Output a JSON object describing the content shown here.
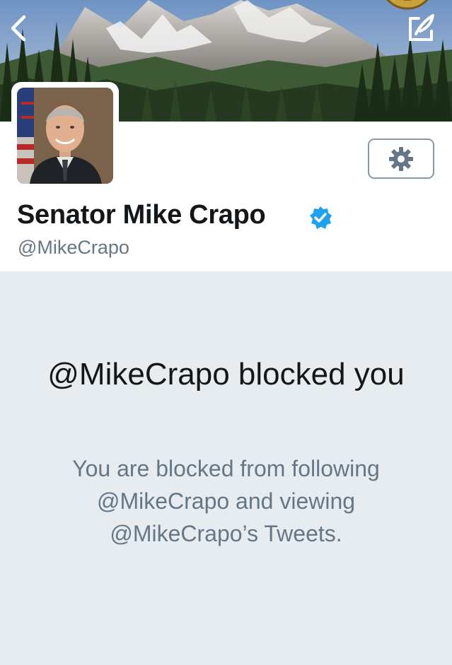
{
  "header": {
    "back_icon": "chevron-left-icon",
    "share_icon": "external-link-icon"
  },
  "profile": {
    "display_name": "Senator Mike Crapo",
    "handle": "@MikeCrapo",
    "verified_icon": "verified-badge-icon",
    "settings_icon": "gear-icon"
  },
  "blocked": {
    "title": "@MikeCrapo blocked you",
    "description": "You are blocked from following @MikeCrapo and viewing @MikeCrapo’s Tweets."
  },
  "colors": {
    "verified": "#1da1f2",
    "secondary_text": "#657786",
    "background": "#e6ecf0"
  }
}
